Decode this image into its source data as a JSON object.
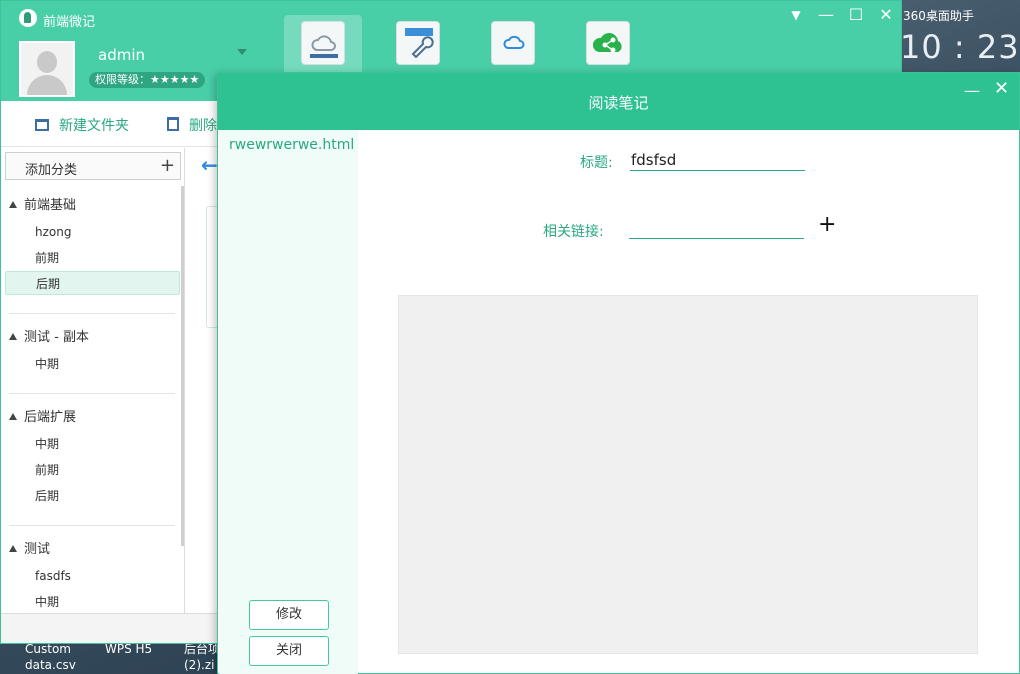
{
  "desktop": {
    "widget_title": "360桌面助手",
    "clock": "10 : 23",
    "icons": [
      {
        "line1": "Custom",
        "line2": "data.csv"
      },
      {
        "line1": "WPS H5",
        "line2": ""
      },
      {
        "line1": "后台项",
        "line2": "(2).zi"
      }
    ]
  },
  "app": {
    "title": "前端微记",
    "username": "admin",
    "permission": "权限等级：★★★★★",
    "modules": [
      "cloud-notes",
      "tools",
      "sync",
      "share"
    ],
    "window_buttons": {
      "dropdown": "▼",
      "minimize": "—",
      "maximize": "☐",
      "close": "✕"
    }
  },
  "toolbar": {
    "new_folder": "新建文件夹",
    "delete": "删除"
  },
  "sidebar": {
    "add_category": "添加分类",
    "add_icon": "+",
    "groups": [
      {
        "title": "前端基础",
        "items": [
          "hzong",
          "前期",
          "后期"
        ]
      },
      {
        "title": "测试 - 副本",
        "items": [
          "中期"
        ]
      },
      {
        "title": "后端扩展",
        "items": [
          "中期",
          "前期",
          "后期"
        ]
      },
      {
        "title": "测试",
        "items": [
          "fasdfs",
          "中期"
        ]
      }
    ],
    "selected": "后期"
  },
  "dialog": {
    "title": "阅读笔记",
    "minimize": "—",
    "close": "✕",
    "file_name": "rwewrwerwe.html",
    "title_label": "标题:",
    "title_value": "fdsfsd",
    "link_label": "相关链接:",
    "link_value": "",
    "add_link": "+",
    "edit_button": "修改",
    "close_button": "关闭"
  },
  "colors": {
    "accent": "#49cfa8",
    "dialog_header": "#2ec292",
    "text_accent": "#2aa882"
  }
}
